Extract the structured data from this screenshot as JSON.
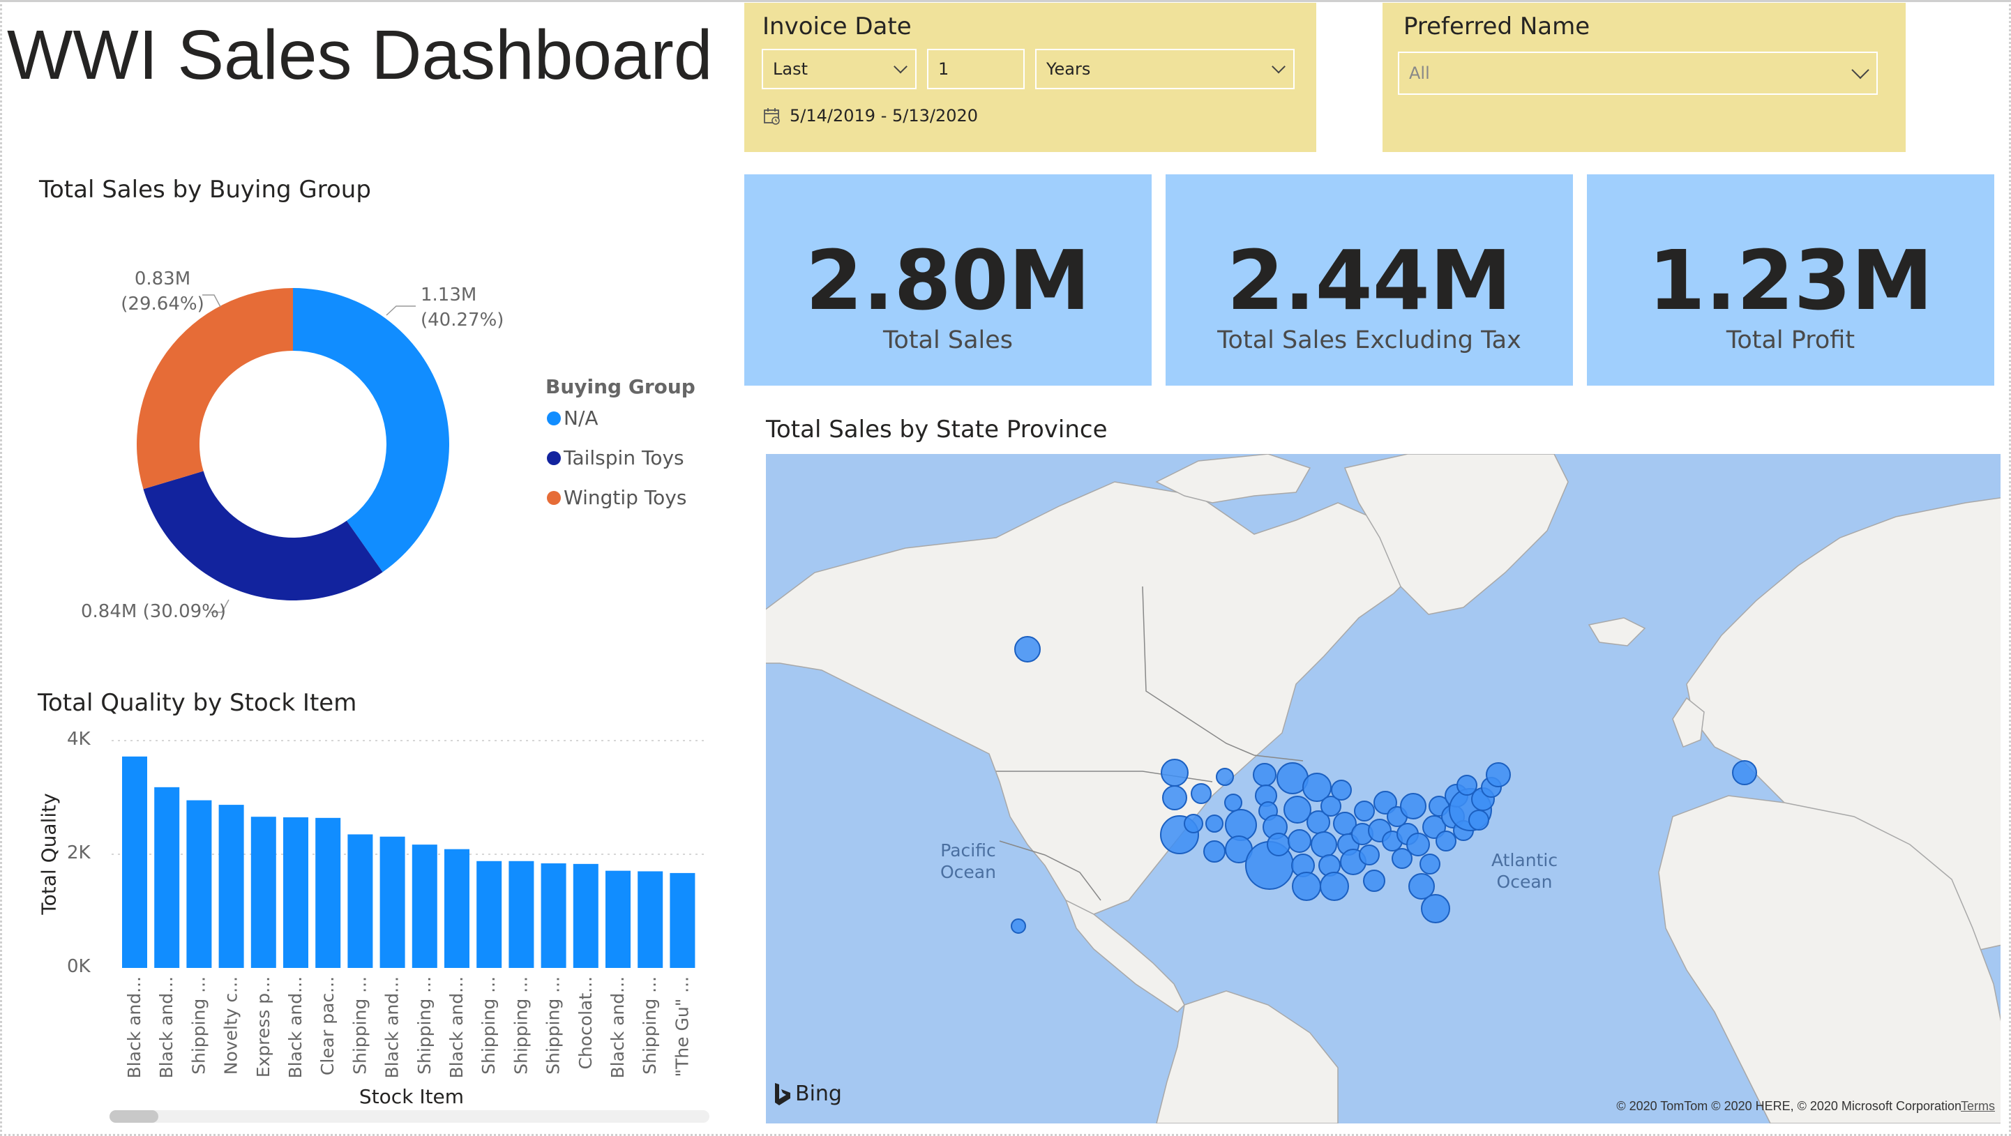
{
  "page": {
    "title": "WWI Sales Dashboard"
  },
  "slicers": {
    "invoice_date": {
      "title": "Invoice Date",
      "mode": "Last",
      "count": "1",
      "unit": "Years",
      "range": "5/14/2019 - 5/13/2020",
      "icon": "calendar-icon"
    },
    "preferred_name": {
      "title": "Preferred Name",
      "value": "All"
    }
  },
  "cards": [
    {
      "value": "2.80M",
      "label": "Total Sales"
    },
    {
      "value": "2.44M",
      "label": "Total Sales Excluding Tax"
    },
    {
      "value": "1.23M",
      "label": "Total Profit"
    }
  ],
  "donut": {
    "title": "Total Sales by Buying Group",
    "legend_title": "Buying Group",
    "labels": {
      "na": [
        "1.13M",
        "(40.27%)"
      ],
      "tailspin": "0.84M (30.09%)",
      "wingtip": [
        "0.83M",
        "(29.64%)"
      ]
    }
  },
  "bar": {
    "title": "Total Quality by Stock Item",
    "xlabel": "Stock Item",
    "ylabel": "Total Quality",
    "ticks": [
      "4K",
      "2K",
      "0K"
    ]
  },
  "map": {
    "title": "Total Sales by State Province",
    "pacific": [
      "Pacific",
      "Ocean"
    ],
    "atlantic": [
      "Atlantic",
      "Ocean"
    ],
    "logo": "Bing",
    "copyright": "© 2020 TomTom © 2020 HERE, © 2020 Microsoft Corporation",
    "terms": "Terms"
  },
  "chart_data": [
    {
      "type": "pie",
      "title": "Total Sales by Buying Group",
      "legend_title": "Buying Group",
      "legend_position": "right",
      "series": [
        {
          "name": "N/A",
          "value": 1.13,
          "percent": 40.27,
          "color": "#118dff"
        },
        {
          "name": "Tailspin Toys",
          "value": 0.84,
          "percent": 30.09,
          "color": "#12239e"
        },
        {
          "name": "Wingtip Toys",
          "value": 0.83,
          "percent": 29.64,
          "color": "#e66c37"
        }
      ]
    },
    {
      "type": "bar",
      "title": "Total Quality by Stock Item",
      "xlabel": "Stock Item",
      "ylabel": "Total Quality",
      "ylim": [
        0,
        4000
      ],
      "grid": true,
      "color": "#118dff",
      "categories": [
        "Black and...",
        "Black and...",
        "Shipping ...",
        "Novelty c...",
        "Express p...",
        "Black and...",
        "Clear pac...",
        "Shipping ...",
        "Black and...",
        "Shipping ...",
        "Black and...",
        "Shipping ...",
        "Shipping ...",
        "Shipping ...",
        "Chocolat...",
        "Black and...",
        "Shipping ...",
        "\"The Gu\" ..."
      ],
      "values": [
        3720,
        3180,
        2950,
        2870,
        2660,
        2650,
        2640,
        2350,
        2310,
        2170,
        2090,
        1880,
        1880,
        1840,
        1830,
        1710,
        1700,
        1670
      ]
    }
  ]
}
